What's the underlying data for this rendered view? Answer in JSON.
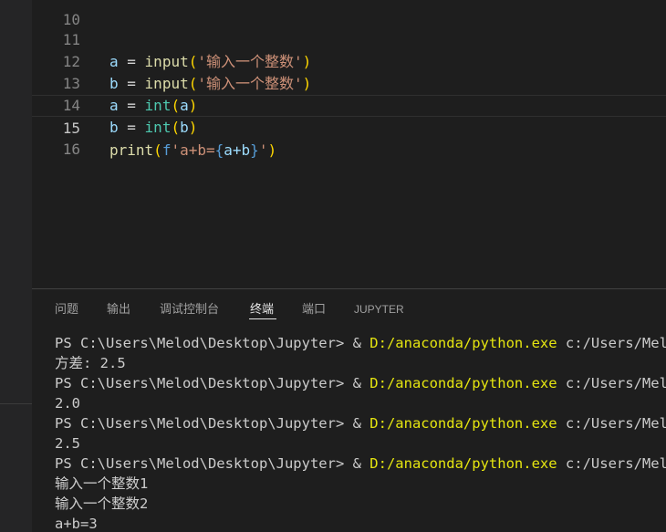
{
  "editor": {
    "lines": [
      {
        "num": "10"
      },
      {
        "num": "11",
        "v": "a",
        "eq": " = ",
        "f": "input",
        "o": "(",
        "s": "'输入一个整数'",
        "c": ")"
      },
      {
        "num": "12",
        "v": "b",
        "eq": " = ",
        "f": "input",
        "o": "(",
        "s": "'输入一个整数'",
        "c": ")"
      },
      {
        "num": "13",
        "v": "a",
        "eq": " = ",
        "f": "int",
        "o": "(",
        "a": "a",
        "c": ")"
      },
      {
        "num": "14",
        "v": "b",
        "eq": " = ",
        "f": "int",
        "o": "(",
        "a": "b",
        "c": ")"
      },
      {
        "num": "15",
        "f": "print",
        "o": "(",
        "pre": "f",
        "s1": "'a+b=",
        "bo": "{",
        "expr": "a+b",
        "bc": "}",
        "s2": "'",
        "c": ")"
      },
      {
        "num": "16"
      }
    ]
  },
  "panel": {
    "tabs": [
      {
        "label": "问题"
      },
      {
        "label": "输出"
      },
      {
        "label": "调试控制台"
      },
      {
        "label": "终端"
      },
      {
        "label": "端口"
      },
      {
        "label": "JUPYTER"
      }
    ],
    "active_tab": "终端"
  },
  "terminal": {
    "prompt": "PS C:\\Users\\Melod\\Desktop\\Jupyter> & ",
    "exe": "D:/anaconda/python.exe",
    "tail": " c:/Users/Melod/",
    "outputs": [
      "方差: 2.5",
      "2.0",
      "2.5",
      "输入一个整数1",
      "输入一个整数2",
      "a+b=3"
    ]
  }
}
